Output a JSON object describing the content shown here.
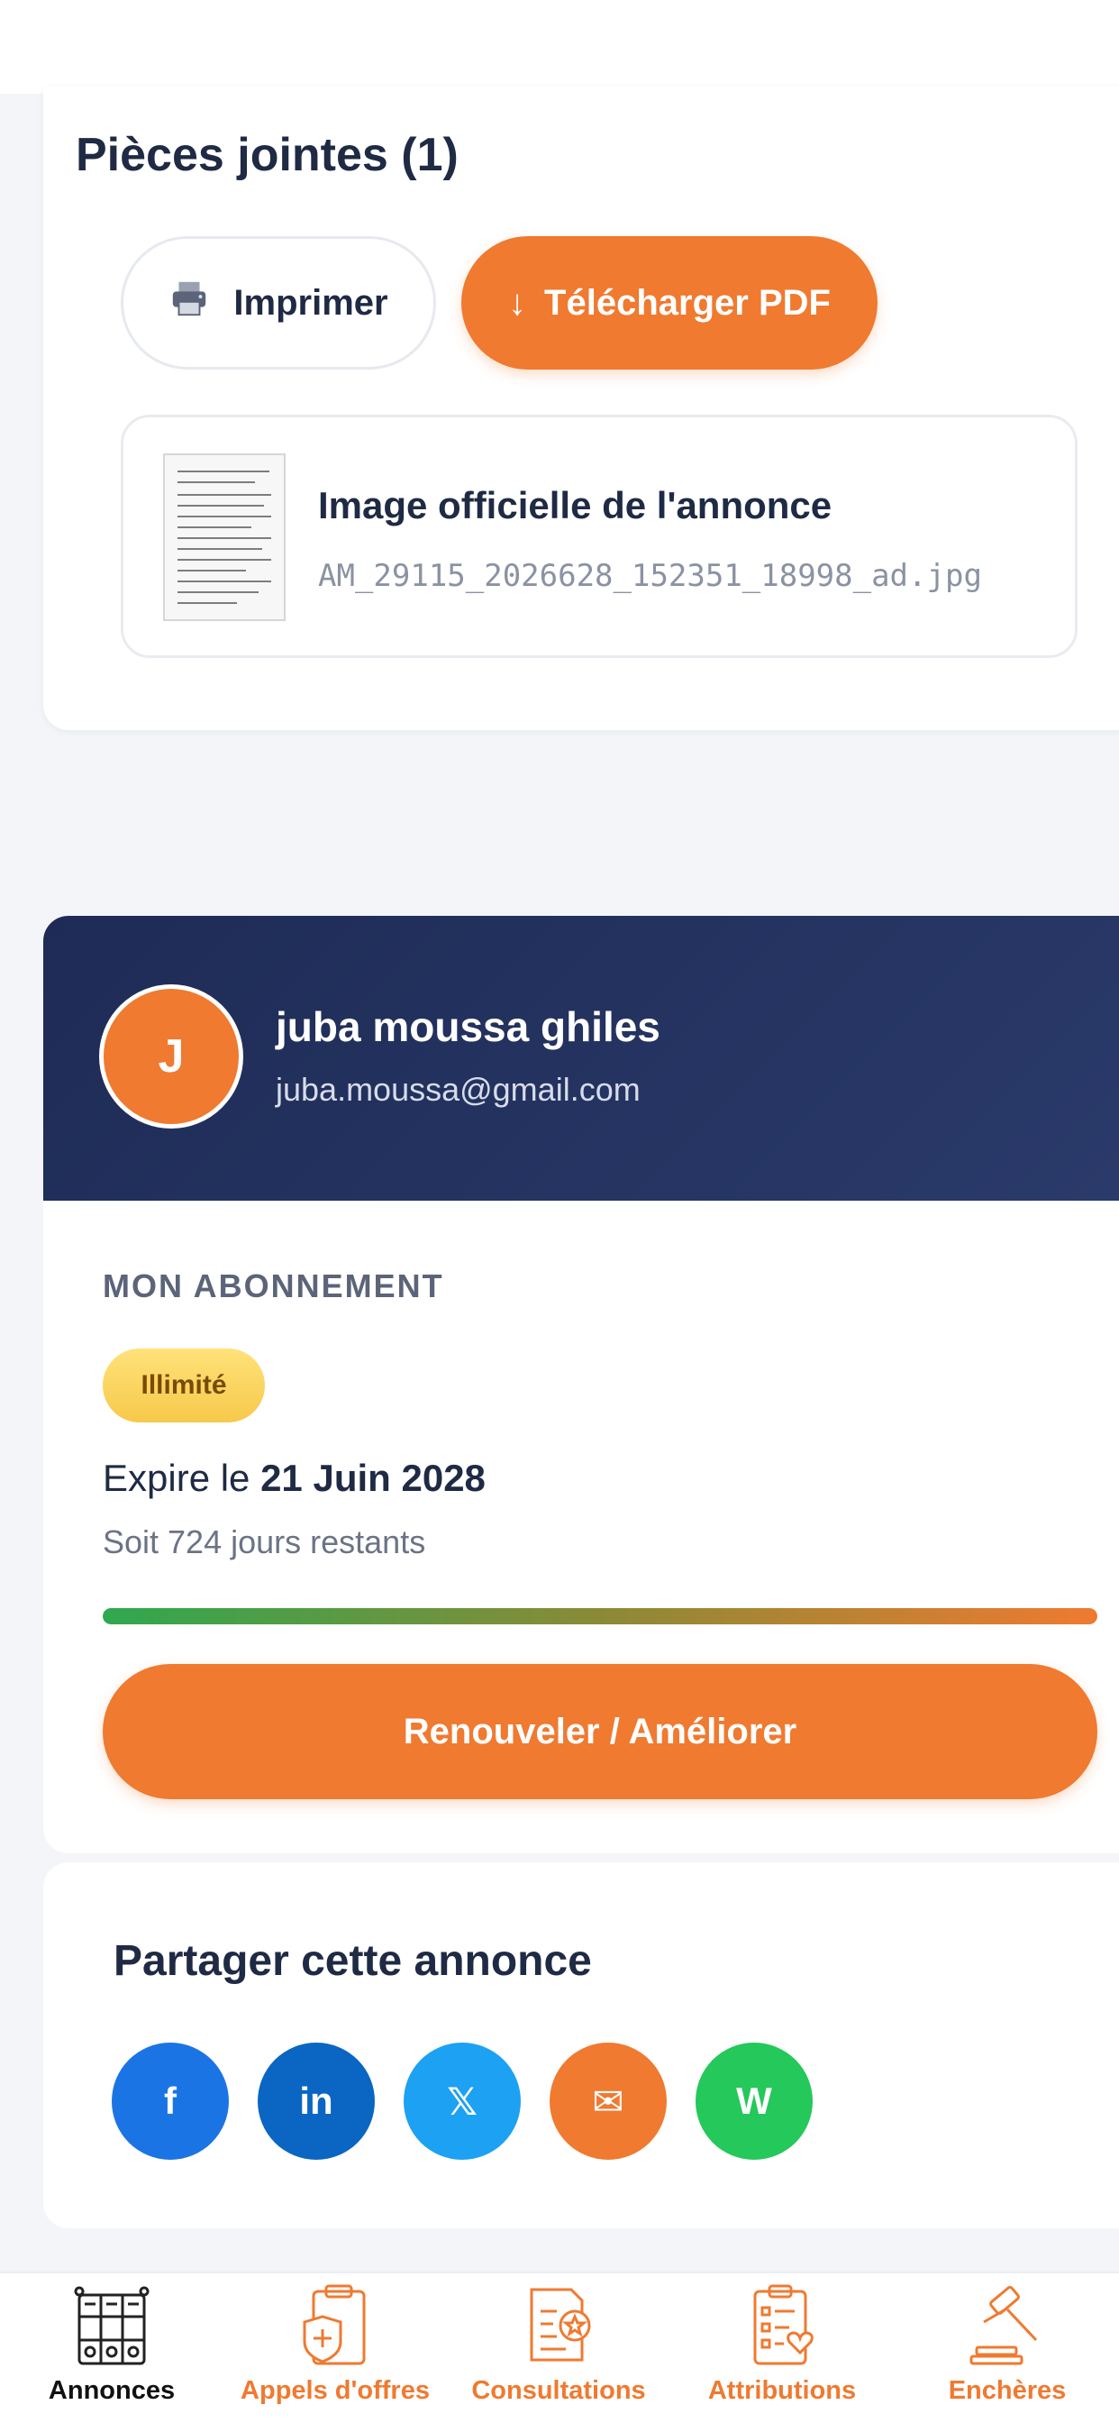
{
  "attachments": {
    "title": "Pièces jointes (1)",
    "print_label": "Imprimer",
    "download_icon": "↓",
    "download_label": "Télécharger PDF",
    "file": {
      "name": "Image officielle de l'annonce",
      "path": "AM_29115_2026628_152351_18998_ad.jpg"
    }
  },
  "profile": {
    "initial": "J",
    "name": "juba moussa ghiles",
    "email": "juba.moussa@gmail.com"
  },
  "subscription": {
    "section_label": "MON ABONNEMENT",
    "badge": "Illimité",
    "expire_prefix": "Expire le ",
    "expire_date": "21 Juin 2028",
    "remaining": "Soit 724 jours restants",
    "progress_fraction": 1.0,
    "renew_label": "Renouveler / Améliorer"
  },
  "share": {
    "title": "Partager cette annonce",
    "buttons": [
      {
        "name": "facebook-share-button",
        "glyph": "f",
        "color": "#1b74e4"
      },
      {
        "name": "linkedin-share-button",
        "glyph": "in",
        "color": "#0a66c2"
      },
      {
        "name": "x-share-button",
        "glyph": "𝕏",
        "color": "#1da1f2"
      },
      {
        "name": "email-share-button",
        "glyph": "✉",
        "color": "#ef7a30"
      },
      {
        "name": "whatsapp-share-button",
        "glyph": "W",
        "color": "#25c85a"
      }
    ]
  },
  "nav": {
    "items": [
      {
        "label": "Annonces",
        "icon": "newspaper-grid-icon",
        "active": true
      },
      {
        "label": "Appels d'offres",
        "icon": "clipboard-medical-icon",
        "active": false
      },
      {
        "label": "Consultations",
        "icon": "document-star-icon",
        "active": false
      },
      {
        "label": "Attributions",
        "icon": "checklist-heart-icon",
        "active": false
      },
      {
        "label": "Enchères",
        "icon": "auction-gavel-icon",
        "active": false
      }
    ]
  },
  "colors": {
    "accent": "#ef7a30",
    "navy": "#1e2b56",
    "text": "#1f2a44"
  }
}
